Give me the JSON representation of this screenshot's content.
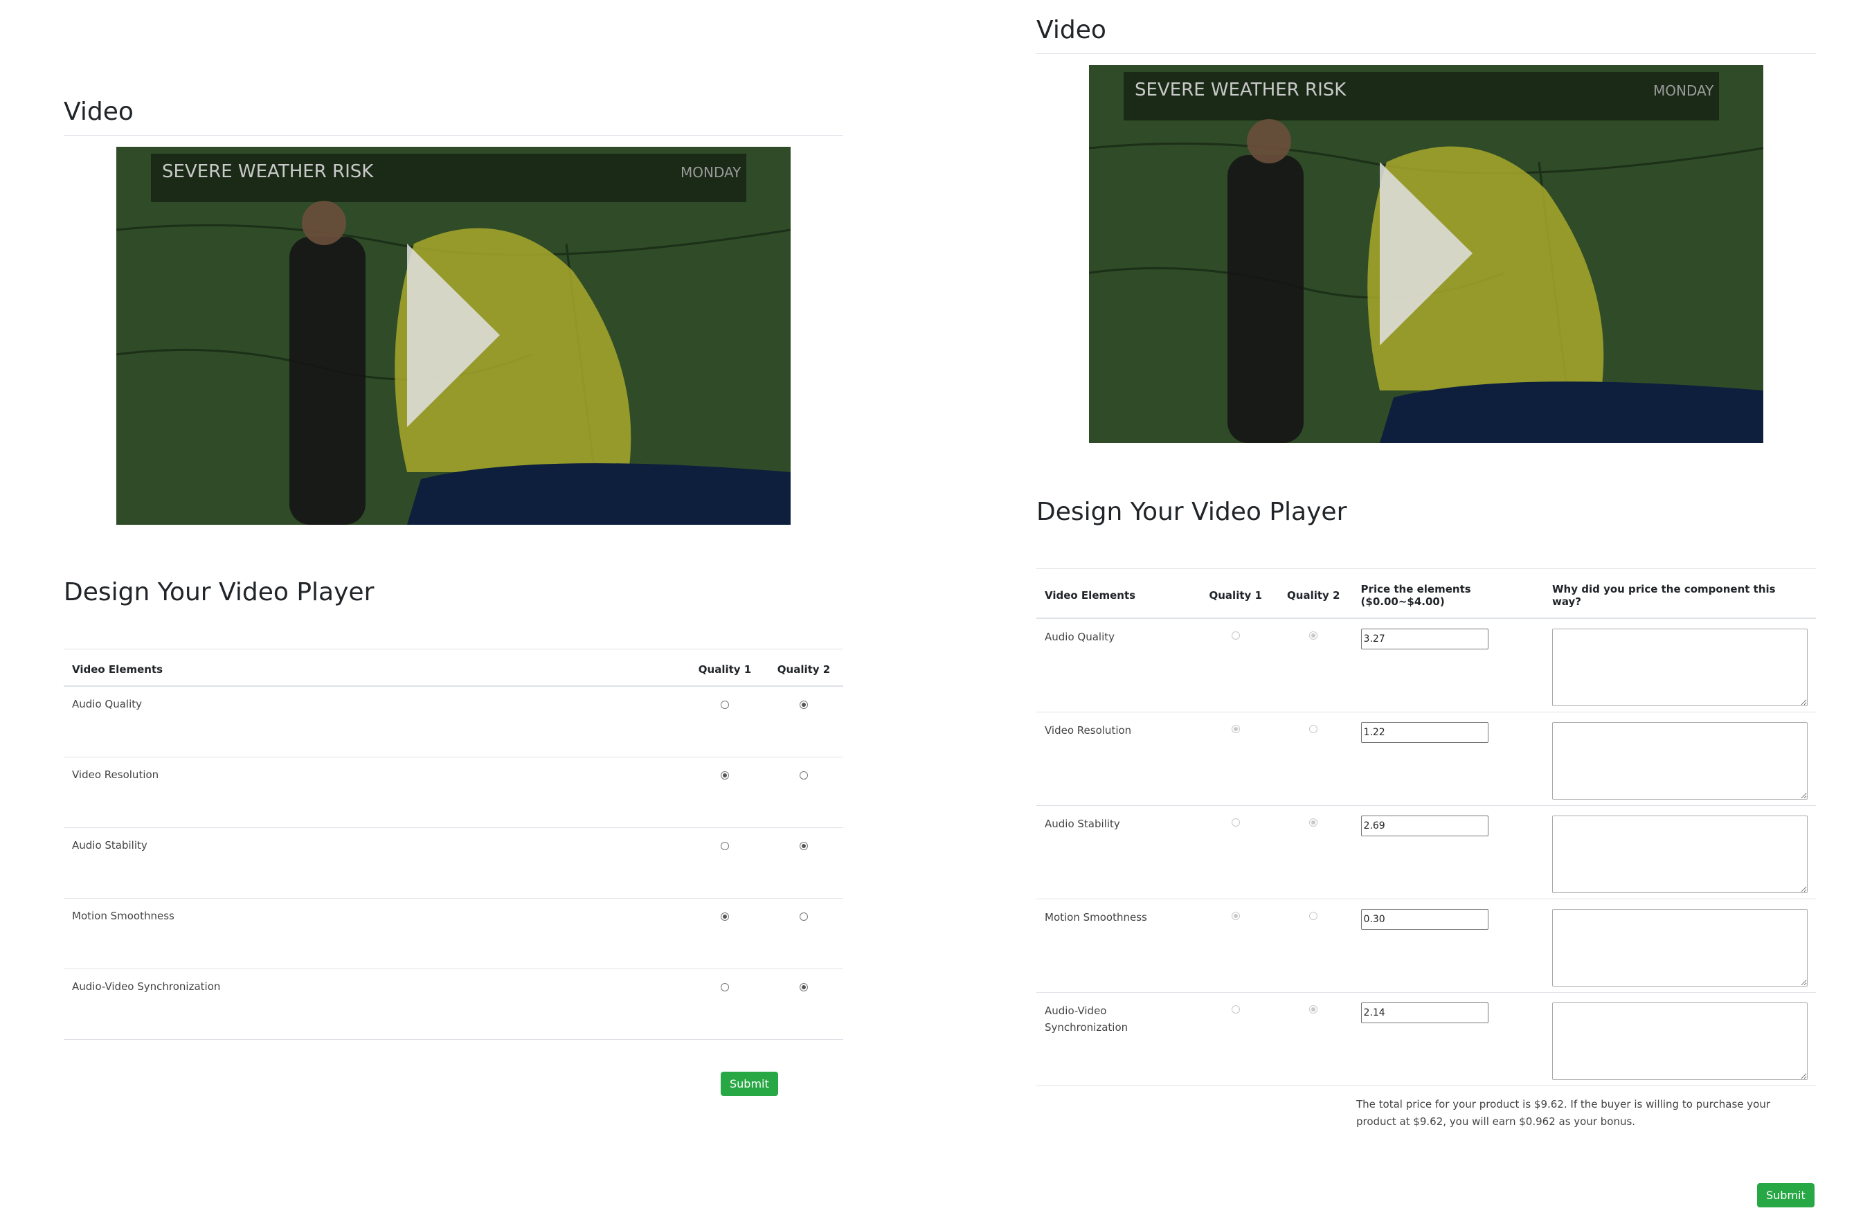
{
  "left": {
    "video_title": "Video",
    "overlay_text": "SEVERE WEATHER RISK",
    "overlay_day": "MONDAY",
    "design_title": "Design Your Video Player",
    "headers": {
      "elements": "Video Elements",
      "quality1": "Quality 1",
      "quality2": "Quality 2"
    },
    "rows": [
      {
        "label": "Audio Quality",
        "selected": 2
      },
      {
        "label": "Video Resolution",
        "selected": 1
      },
      {
        "label": "Audio Stability",
        "selected": 2
      },
      {
        "label": "Motion Smoothness",
        "selected": 1
      },
      {
        "label": "Audio-Video Synchronization",
        "selected": 2
      }
    ],
    "submit_label": "Submit"
  },
  "right": {
    "video_title": "Video",
    "overlay_text": "SEVERE WEATHER RISK",
    "overlay_day": "MONDAY",
    "design_title": "Design Your Video Player",
    "headers": {
      "elements": "Video Elements",
      "quality1": "Quality 1",
      "quality2": "Quality 2",
      "price": "Price the elements ($0.00~$4.00)",
      "why": "Why did you price the component this way?"
    },
    "rows": [
      {
        "label": "Audio Quality",
        "selected": 2,
        "price": "3.27",
        "why": ""
      },
      {
        "label": "Video Resolution",
        "selected": 1,
        "price": "1.22",
        "why": ""
      },
      {
        "label": "Audio Stability",
        "selected": 2,
        "price": "2.69",
        "why": ""
      },
      {
        "label": "Motion Smoothness",
        "selected": 1,
        "price": "0.30",
        "why": ""
      },
      {
        "label": "Audio-Video Synchronization",
        "selected": 2,
        "price": "2.14",
        "why": ""
      }
    ],
    "total_note": "The total price for your product is $9.62. If the buyer is willing to purchase your product at $9.62, you will earn $0.962 as your bonus.",
    "submit_label": "Submit"
  },
  "colors": {
    "submit_bg": "#28a745",
    "map_green": "#2f4b27",
    "risk_yellow": "#a7a82c",
    "water": "#0d1f3d"
  },
  "icons": {
    "play": "play-icon",
    "radio_on": "radio-checked",
    "radio_off": "radio-unchecked"
  }
}
